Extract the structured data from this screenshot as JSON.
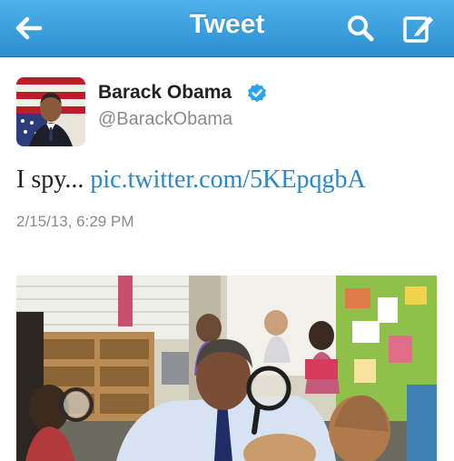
{
  "header": {
    "title": "Tweet"
  },
  "tweet": {
    "author_name": "Barack Obama",
    "author_handle": "@BarackObama",
    "text_prefix": "I spy... ",
    "link_text": "pic.twitter.com/5KEpqgbA",
    "timestamp": "2/15/13, 6:29 PM"
  },
  "icons": {
    "back": "back-arrow-icon",
    "search": "search-icon",
    "compose": "compose-icon",
    "verified": "verified-badge-icon"
  },
  "colors": {
    "nav_bar": "#2b8fd0",
    "link": "#2a87c8",
    "verified": "#2aa3ef",
    "meta_text": "#8a8a8a"
  }
}
